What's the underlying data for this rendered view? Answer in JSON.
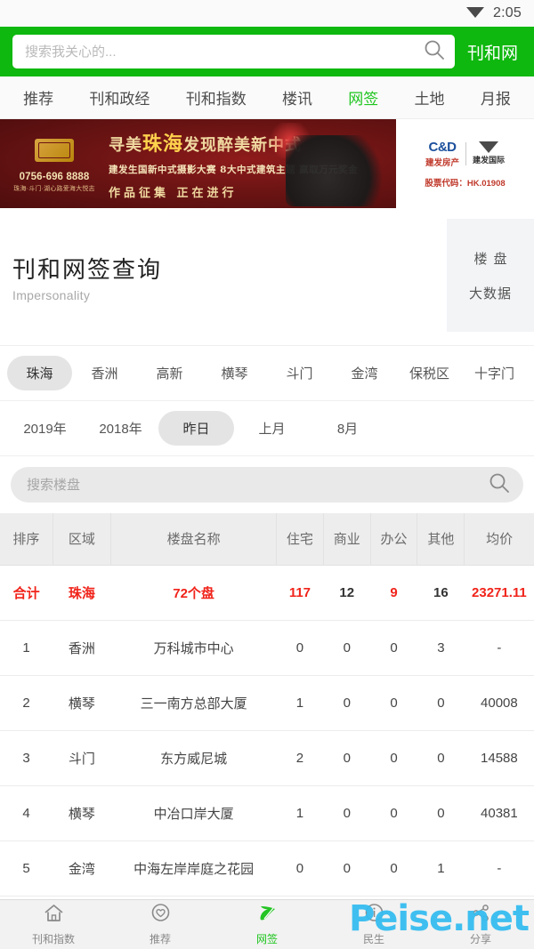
{
  "status_bar": {
    "time": "2:05",
    "wifi_icon": "wifi-icon"
  },
  "header": {
    "search_placeholder": "搜索我关心的...",
    "search_value": "",
    "search_icon": "search-icon",
    "brand": "刊和网",
    "accent_green": "#0eb80e"
  },
  "nav_tabs": [
    {
      "label": "推荐",
      "active": false
    },
    {
      "label": "刊和政经",
      "active": false
    },
    {
      "label": "刊和指数",
      "active": false
    },
    {
      "label": "楼讯",
      "active": false
    },
    {
      "label": "网签",
      "active": true
    },
    {
      "label": "土地",
      "active": false
    },
    {
      "label": "月报",
      "active": false
    }
  ],
  "ad": {
    "logo_phone": "0756-696 8888",
    "logo_address": "珠海·斗门·湖心路爱海大悦志",
    "headline_pre": "寻美",
    "headline_hl": "珠海",
    "headline_post": "发现醉美新中式",
    "sub1": "建发生国新中式摄影大赛 8大中式建筑主题  赢取万元奖金",
    "sub2": "作品征集    正在进行",
    "cd_mark": "C&D",
    "cd_cn": "建发房产",
    "cd_cn2": "建发国际",
    "stock_code": "股票代码：HK.01908"
  },
  "page_title": {
    "cn": "刊和网签查询",
    "en": "Impersonality"
  },
  "side_panel": {
    "item1": "楼盘",
    "item2": "大数据"
  },
  "district_filters": [
    {
      "label": "珠海",
      "active": true
    },
    {
      "label": "香洲",
      "active": false
    },
    {
      "label": "高新",
      "active": false
    },
    {
      "label": "横琴",
      "active": false
    },
    {
      "label": "斗门",
      "active": false
    },
    {
      "label": "金湾",
      "active": false
    },
    {
      "label": "保税区",
      "active": false
    },
    {
      "label": "十字门",
      "active": false
    }
  ],
  "date_filters": [
    {
      "label": "2019年",
      "active": false
    },
    {
      "label": "2018年",
      "active": false
    },
    {
      "label": "昨日",
      "active": true
    },
    {
      "label": "上月",
      "active": false
    },
    {
      "label": "8月",
      "active": false
    }
  ],
  "estate_search": {
    "placeholder": "搜索楼盘",
    "value": "",
    "icon": "search-icon"
  },
  "table": {
    "columns": [
      "排序",
      "区域",
      "楼盘名称",
      "住宅",
      "商业",
      "办公",
      "其他",
      "均价"
    ],
    "total_row": {
      "rank": "合计",
      "area": "珠海",
      "name": "72个盘",
      "residential": "117",
      "commercial": "12",
      "office": "9",
      "other": "16",
      "avg_price": "23271.11"
    },
    "rows": [
      {
        "rank": "1",
        "area": "香洲",
        "name": "万科城市中心",
        "residential": "0",
        "commercial": "0",
        "office": "0",
        "other": "3",
        "avg_price": "-"
      },
      {
        "rank": "2",
        "area": "横琴",
        "name": "三一南方总部大厦",
        "residential": "1",
        "commercial": "0",
        "office": "0",
        "other": "0",
        "avg_price": "40008"
      },
      {
        "rank": "3",
        "area": "斗门",
        "name": "东方威尼城",
        "residential": "2",
        "commercial": "0",
        "office": "0",
        "other": "0",
        "avg_price": "14588"
      },
      {
        "rank": "4",
        "area": "横琴",
        "name": "中冶口岸大厦",
        "residential": "1",
        "commercial": "0",
        "office": "0",
        "other": "0",
        "avg_price": "40381"
      },
      {
        "rank": "5",
        "area": "金湾",
        "name": "中海左岸岸庭之花园",
        "residential": "0",
        "commercial": "0",
        "office": "0",
        "other": "1",
        "avg_price": "-"
      }
    ]
  },
  "bottom_nav": [
    {
      "label": "刊和指数",
      "icon": "home-icon",
      "active": false
    },
    {
      "label": "推荐",
      "icon": "heart-circle-icon",
      "active": false
    },
    {
      "label": "网签",
      "icon": "leaf-icon",
      "active": true
    },
    {
      "label": "民生",
      "icon": "info-circle-icon",
      "active": false
    },
    {
      "label": "分享",
      "icon": "share-icon",
      "active": false
    }
  ],
  "watermark": {
    "text": "Peise.net",
    "color": "#36bdf0"
  }
}
